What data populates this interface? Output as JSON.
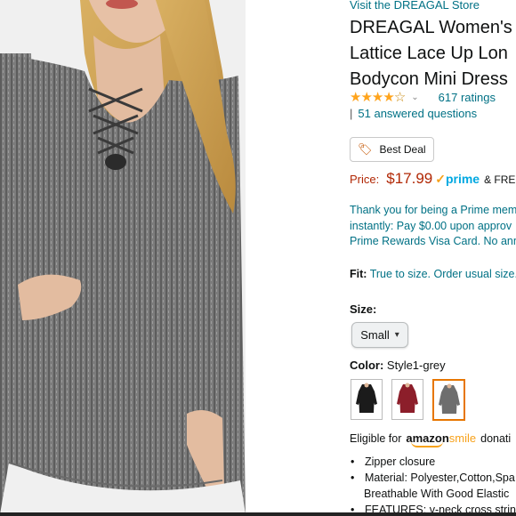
{
  "store": {
    "link_text": "Visit the DREAGAL Store"
  },
  "product": {
    "title_lines": [
      "DREAGAL Women's",
      "Lattice Lace Up Lon",
      "Bodycon Mini Dress"
    ],
    "rating_stars": 4,
    "ratings_count": "617 ratings",
    "qa_separator": "|",
    "answered_questions": "51 answered questions"
  },
  "badge": {
    "label": "Best Deal",
    "icon": "tag-icon"
  },
  "price": {
    "label": "Price:",
    "value": "$17.99",
    "prime_check": "✓",
    "prime_text": "prime",
    "free_text": "& FREE R"
  },
  "prime_message": [
    "Thank you for being a Prime mem",
    "instantly: Pay $0.00 upon approv",
    "Prime Rewards Visa Card. No ann"
  ],
  "fit": {
    "label": "Fit:",
    "value": "True to size. Order usual size."
  },
  "size": {
    "label": "Size:",
    "selected": "Small"
  },
  "color": {
    "label": "Color:",
    "selected": "Style1-grey",
    "swatches": [
      {
        "name": "black",
        "hex": "#1b1b1b"
      },
      {
        "name": "wine-red",
        "hex": "#8c1e2a"
      },
      {
        "name": "grey",
        "hex": "#6e6e6e"
      }
    ]
  },
  "smile": {
    "prefix": "Eligible for",
    "logo_amazon": "amazon",
    "logo_smile": "smile",
    "suffix": "donati"
  },
  "features": [
    {
      "bullet": "•",
      "text": "Zipper closure"
    },
    {
      "bullet": "•",
      "text": "Material: Polyester,Cotton,Spa"
    },
    {
      "bullet": "",
      "text": "Breathable With Good Elastic"
    },
    {
      "bullet": "•",
      "text": "FEATURES: v-neck cross string"
    }
  ],
  "colors": {
    "link": "#007185",
    "price": "#B12704",
    "star": "#FFA41C",
    "selected_swatch_border": "#e77600"
  }
}
